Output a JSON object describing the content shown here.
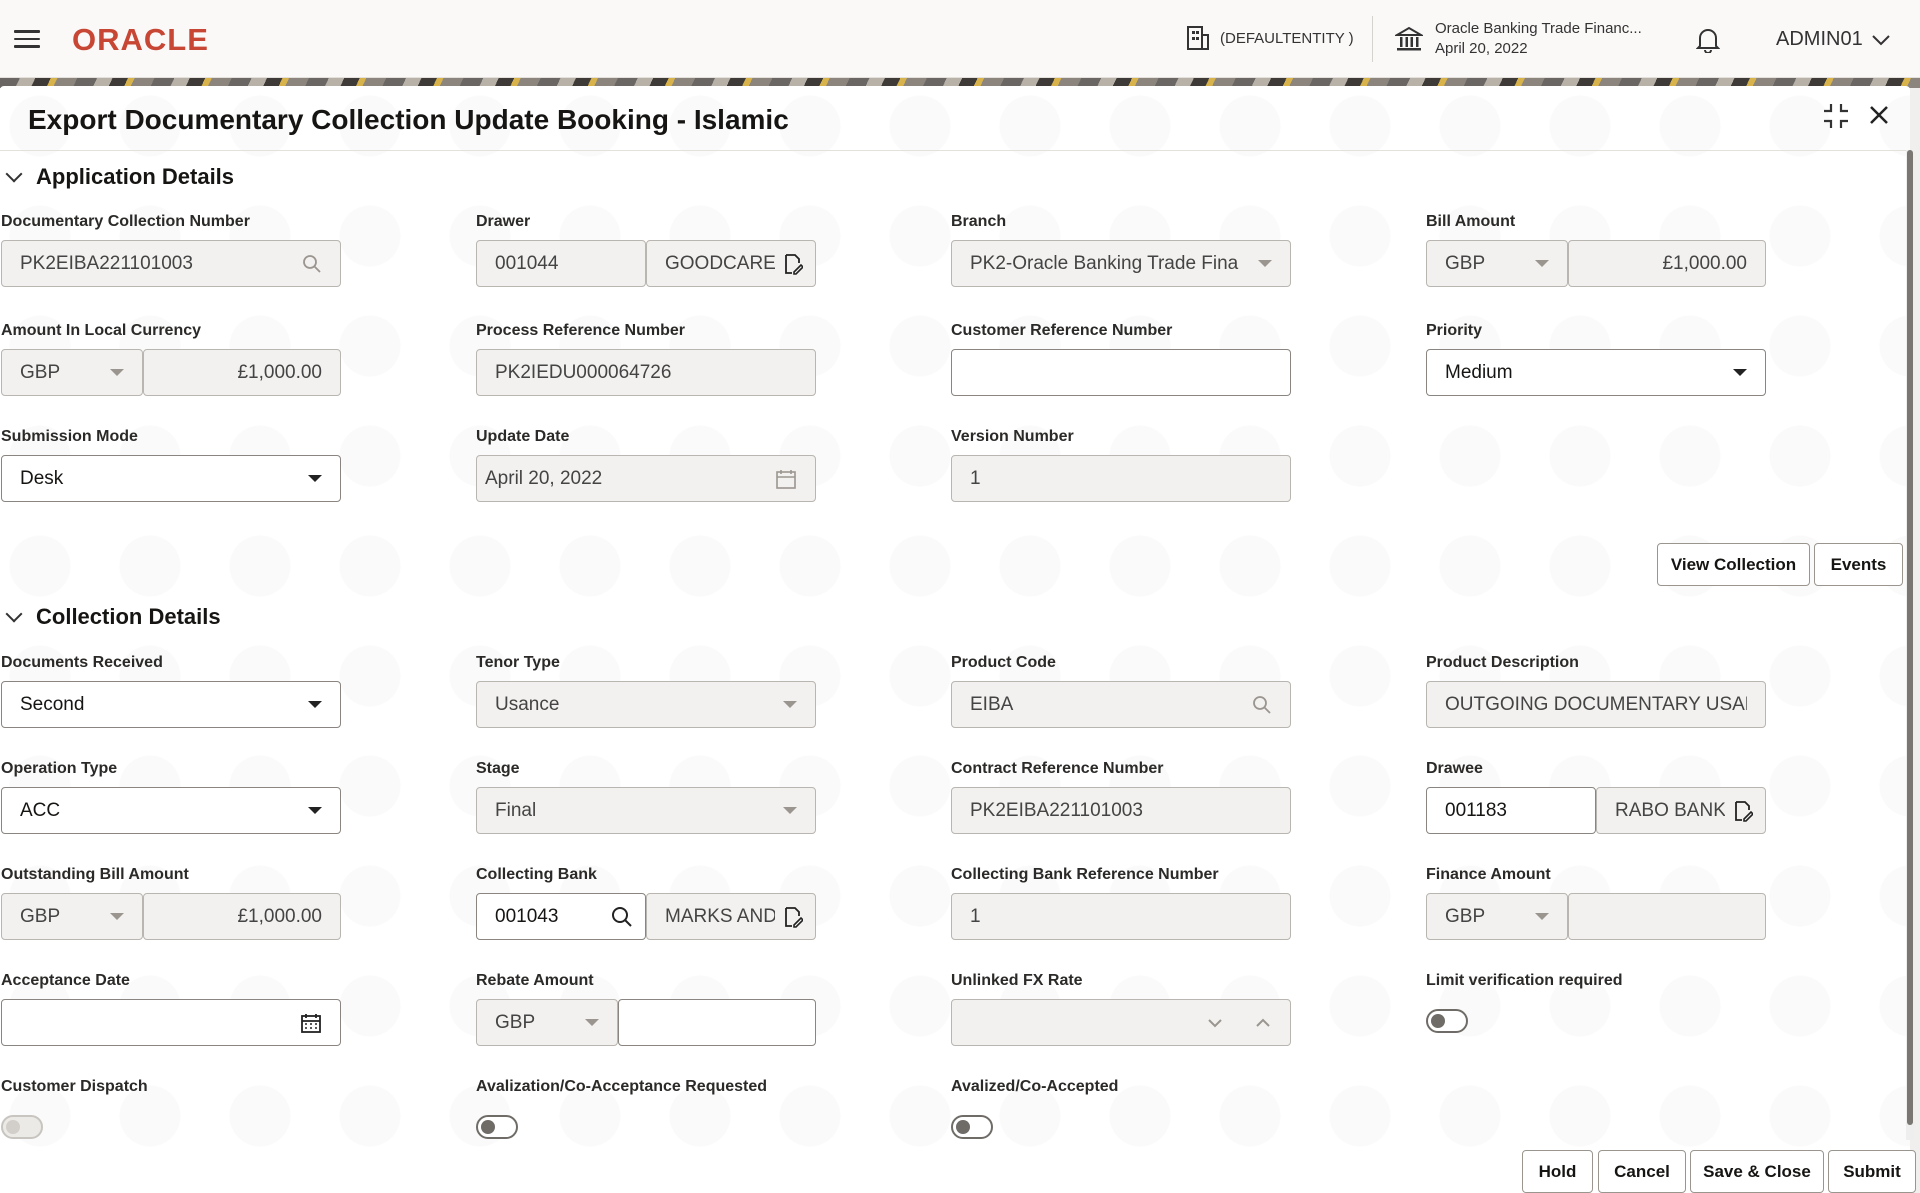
{
  "header": {
    "logo": "ORACLE",
    "entity": "(DEFAULTENTITY )",
    "bank_name": "Oracle Banking Trade Financ...",
    "bank_date": "April 20, 2022",
    "user": "ADMIN01"
  },
  "panel": {
    "title": "Export Documentary Collection Update Booking - Islamic"
  },
  "application_details": {
    "section_label": "Application Details",
    "doc_collection_number": {
      "label": "Documentary Collection Number",
      "value": "PK2EIBA221101003"
    },
    "drawer": {
      "label": "Drawer",
      "id": "001044",
      "name": "GOODCARE"
    },
    "branch": {
      "label": "Branch",
      "value": "PK2-Oracle Banking Trade Fina"
    },
    "bill_amount": {
      "label": "Bill Amount",
      "currency": "GBP",
      "value": "£1,000.00"
    },
    "amount_local": {
      "label": "Amount In Local Currency",
      "currency": "GBP",
      "value": "£1,000.00"
    },
    "process_ref": {
      "label": "Process Reference Number",
      "value": "PK2IEDU000064726"
    },
    "customer_ref": {
      "label": "Customer Reference Number",
      "value": ""
    },
    "priority": {
      "label": "Priority",
      "value": "Medium"
    },
    "submission_mode": {
      "label": "Submission Mode",
      "value": "Desk"
    },
    "update_date": {
      "label": "Update Date",
      "value": "April 20, 2022"
    },
    "version_number": {
      "label": "Version Number",
      "value": "1"
    },
    "view_collection_label": "View Collection",
    "events_label": "Events"
  },
  "collection_details": {
    "section_label": "Collection Details",
    "documents_received": {
      "label": "Documents Received",
      "value": "Second"
    },
    "tenor_type": {
      "label": "Tenor Type",
      "value": "Usance"
    },
    "product_code": {
      "label": "Product Code",
      "value": "EIBA"
    },
    "product_description": {
      "label": "Product Description",
      "value": "OUTGOING DOCUMENTARY USANCE"
    },
    "operation_type": {
      "label": "Operation Type",
      "value": "ACC"
    },
    "stage": {
      "label": "Stage",
      "value": "Final"
    },
    "contract_ref": {
      "label": "Contract Reference Number",
      "value": "PK2EIBA221101003"
    },
    "drawee": {
      "label": "Drawee",
      "id": "001183",
      "name": "RABO BANK"
    },
    "outstanding_bill": {
      "label": "Outstanding Bill Amount",
      "currency": "GBP",
      "value": "£1,000.00"
    },
    "collecting_bank": {
      "label": "Collecting Bank",
      "id": "001043",
      "name": "MARKS AND"
    },
    "collecting_bank_ref": {
      "label": "Collecting Bank Reference Number",
      "value": "1"
    },
    "finance_amount": {
      "label": "Finance Amount",
      "currency": "GBP",
      "value": ""
    },
    "acceptance_date": {
      "label": "Acceptance Date",
      "value": ""
    },
    "rebate_amount": {
      "label": "Rebate Amount",
      "currency": "GBP",
      "value": ""
    },
    "unlinked_fx_rate": {
      "label": "Unlinked FX Rate",
      "value": ""
    },
    "limit_verification": {
      "label": "Limit verification required",
      "checked": false
    },
    "customer_dispatch": {
      "label": "Customer Dispatch",
      "checked": false
    },
    "avalization_requested": {
      "label": "Avalization/Co-Acceptance Requested",
      "checked": false
    },
    "avalized": {
      "label": "Avalized/Co-Accepted",
      "checked": false
    }
  },
  "footer": {
    "hold": "Hold",
    "cancel": "Cancel",
    "save_close": "Save & Close",
    "submit": "Submit"
  }
}
